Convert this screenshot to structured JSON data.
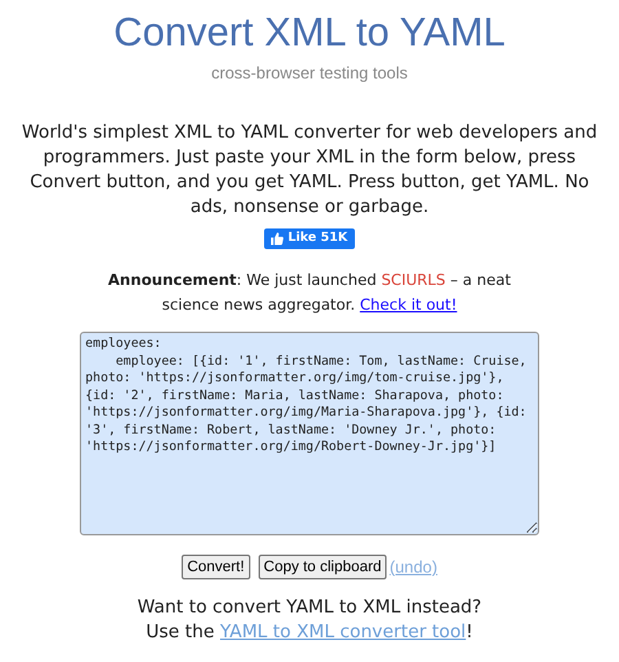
{
  "header": {
    "title": "Convert XML to YAML",
    "subtitle": "cross-browser testing tools"
  },
  "intro": "World's simplest XML to YAML converter for web developers and programmers. Just paste your XML in the form below, press Convert button, and you get YAML. Press button, get YAML. No ads, nonsense or garbage.",
  "like_button": {
    "label": "Like 51K"
  },
  "announcement": {
    "label": "Announcement",
    "text_before": ": We just launched ",
    "brand": "SCIURLS",
    "text_after": " – a neat science news aggregator. ",
    "link": "Check it out!"
  },
  "editor": {
    "value": "employees:\n    employee: [{id: '1', firstName: Tom, lastName: Cruise, photo: 'https://jsonformatter.org/img/tom-cruise.jpg'}, {id: '2', firstName: Maria, lastName: Sharapova, photo: 'https://jsonformatter.org/img/Maria-Sharapova.jpg'}, {id: '3', firstName: Robert, lastName: 'Downey Jr.', photo: 'https://jsonformatter.org/img/Robert-Downey-Jr.jpg'}]"
  },
  "buttons": [
    {
      "label": "Convert!",
      "kind": "button"
    },
    {
      "label": "Copy to clipboard",
      "kind": "button"
    },
    {
      "label": "(undo)",
      "kind": "link"
    }
  ],
  "footer": {
    "question": "Want to convert YAML to XML instead?",
    "text_before": "Use the ",
    "link": "YAML to XML converter tool",
    "text_after": "!"
  }
}
